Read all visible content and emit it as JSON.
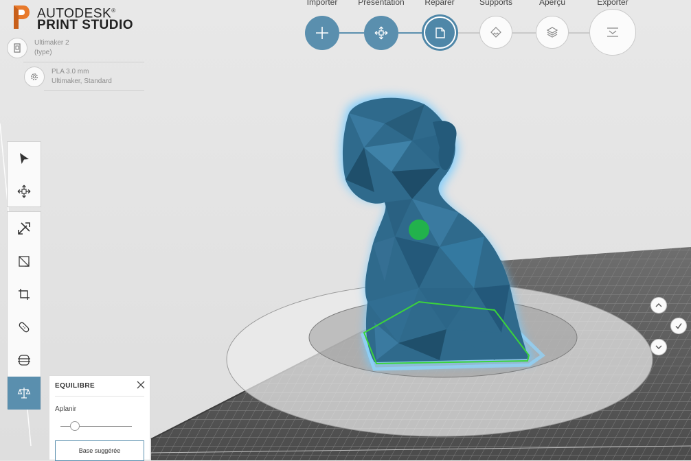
{
  "brand": {
    "line1": "AUTODESK",
    "registered": "®",
    "line2": "PRINT STUDIO"
  },
  "printer": {
    "name": "Ultimaker 2",
    "type": "(type)"
  },
  "material": {
    "name": "PLA 3.0 mm",
    "detail": "Ultimaker, Standard"
  },
  "workflow": {
    "steps": [
      {
        "label": "Importer",
        "state": "done",
        "icon": "plus-icon"
      },
      {
        "label": "Présentation",
        "state": "done",
        "icon": "move-icon"
      },
      {
        "label": "Réparer",
        "state": "active",
        "icon": "document-icon"
      },
      {
        "label": "Supports",
        "state": "todo",
        "icon": "supports-icon"
      },
      {
        "label": "Aperçu",
        "state": "todo",
        "icon": "layers-icon"
      },
      {
        "label": "Exporter",
        "state": "todo",
        "icon": "export-icon"
      }
    ]
  },
  "toolbar": {
    "top": [
      "select-arrow-icon",
      "move-icon"
    ],
    "repair": [
      "repair-tools-icon",
      "resize-icon",
      "crop-icon",
      "bandage-icon",
      "slice-icon",
      "balance-icon"
    ],
    "active_tool": "balance-icon"
  },
  "panel": {
    "title": "EQUILIBRE",
    "slider_label": "Aplanir",
    "slider_value": 0.2,
    "button_label": "Base suggérée"
  },
  "view_controls": [
    "chevron-up-icon",
    "check-icon",
    "chevron-down-icon"
  ],
  "colors": {
    "accent": "#5a8fae",
    "model": "#2f6a8c",
    "model_glow": "#6fc9ff",
    "center_of_mass": "#22b24c",
    "base_outline": "#3bd43b",
    "background": "#e6e6e6"
  }
}
